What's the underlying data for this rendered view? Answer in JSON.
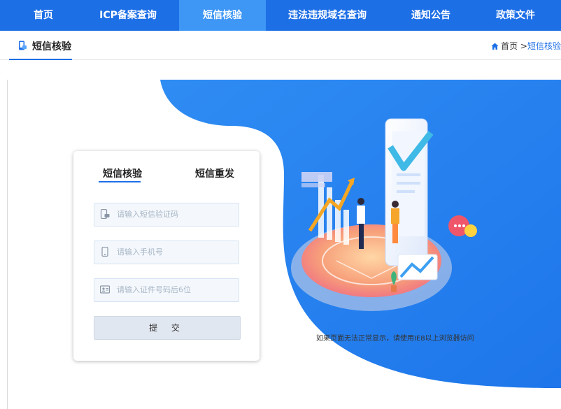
{
  "nav": {
    "items": [
      {
        "label": "首页"
      },
      {
        "label": "ICP备案查询"
      },
      {
        "label": "短信核验"
      },
      {
        "label": "违法违规域名查询"
      },
      {
        "label": "通知公告"
      },
      {
        "label": "政策文件"
      }
    ],
    "active_index": 2
  },
  "breadcrumb": {
    "page_title": "短信核验",
    "home": "首页",
    "separator": ">",
    "current": "短信核验"
  },
  "form": {
    "tabs": [
      {
        "label": "短信核验"
      },
      {
        "label": "短信重发"
      }
    ],
    "active_tab": 0,
    "fields": {
      "sms_code": {
        "placeholder": "请输入短信验证码",
        "value": "",
        "icon": "mobile-sms-icon"
      },
      "phone": {
        "placeholder": "请输入手机号",
        "value": "",
        "icon": "phone-icon"
      },
      "id_number": {
        "placeholder": "请输入证件号码后6位",
        "value": "",
        "icon": "id-card-icon"
      }
    },
    "submit_label": "提 交"
  },
  "notice": "如果页面无法正常显示，请使用IE8以上浏览器访问",
  "colors": {
    "nav_bg": "#1d6fe6",
    "nav_active": "#3e96f5",
    "accent_blue": "#2a85f0",
    "field_bg": "#f4f8fd",
    "button_bg": "#e1e7f0"
  }
}
